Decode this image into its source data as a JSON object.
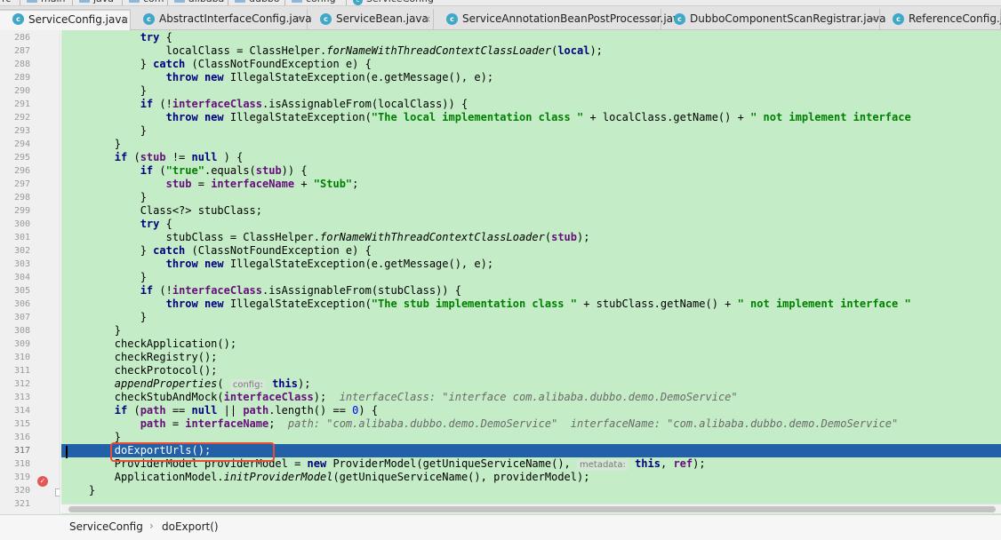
{
  "nav_breadcrumb": [
    {
      "label": "rc",
      "icon": "none"
    },
    {
      "label": "main",
      "icon": "folder-icon"
    },
    {
      "label": "java",
      "icon": "folder-icon"
    },
    {
      "label": "com",
      "icon": "folder-icon"
    },
    {
      "label": "alibaba",
      "icon": "folder-icon"
    },
    {
      "label": "dubbo",
      "icon": "folder-icon"
    },
    {
      "label": "config",
      "icon": "folder-icon"
    },
    {
      "label": "ServiceConfig",
      "icon": "class-icon"
    }
  ],
  "tabs": [
    {
      "label": "ServiceConfig.java",
      "active": true,
      "icon": "class-icon",
      "close": "×"
    },
    {
      "label": "AbstractInterfaceConfig.java",
      "active": false,
      "icon": "class-icon",
      "close": "×"
    },
    {
      "label": "ServiceBean.java",
      "active": false,
      "icon": "class-icon",
      "close": "×"
    },
    {
      "label": "ServiceAnnotationBeanPostProcessor.java",
      "active": false,
      "icon": "class-icon",
      "close": "×"
    },
    {
      "label": "DubboComponentScanRegistrar.java",
      "active": false,
      "icon": "class-icon",
      "close": "×"
    },
    {
      "label": "ReferenceConfig.java",
      "active": false,
      "icon": "class-icon",
      "close": ""
    }
  ],
  "icon_letter": "c",
  "line_numbers": [
    "286",
    "287",
    "288",
    "289",
    "290",
    "291",
    "292",
    "293",
    "294",
    "295",
    "296",
    "297",
    "298",
    "299",
    "300",
    "301",
    "302",
    "303",
    "304",
    "305",
    "306",
    "307",
    "308",
    "309",
    "310",
    "311",
    "312",
    "313",
    "314",
    "315",
    "316",
    "317",
    "318",
    "319",
    "320",
    "321"
  ],
  "highlighted_line": "317",
  "breakpoint_icon": "✓",
  "code_lines": [
    [
      [
        "",
        "            "
      ],
      [
        "kw",
        "try"
      ],
      [
        "",
        " {"
      ]
    ],
    [
      [
        "",
        "                localClass = ClassHelper."
      ],
      [
        "ital",
        "forNameWithThreadContextClassLoader"
      ],
      [
        "",
        "("
      ],
      [
        "kw",
        "local"
      ],
      [
        "",
        ");"
      ]
    ],
    [
      [
        "",
        "            } "
      ],
      [
        "kw",
        "catch"
      ],
      [
        "",
        " (ClassNotFoundException e) {"
      ]
    ],
    [
      [
        "",
        "                "
      ],
      [
        "kw",
        "throw new"
      ],
      [
        "",
        " IllegalStateException(e.getMessage(), e);"
      ]
    ],
    [
      [
        "",
        "            }"
      ]
    ],
    [
      [
        "",
        "            "
      ],
      [
        "kw",
        "if"
      ],
      [
        "",
        " (!"
      ],
      [
        "fld",
        "interfaceClass"
      ],
      [
        "",
        ".isAssignableFrom(localClass)) {"
      ]
    ],
    [
      [
        "",
        "                "
      ],
      [
        "kw",
        "throw new"
      ],
      [
        "",
        " IllegalStateException("
      ],
      [
        "str",
        "\"The local implementation class \""
      ],
      [
        "",
        " + localClass.getName() + "
      ],
      [
        "str",
        "\" not implement interface "
      ]
    ],
    [
      [
        "",
        "            }"
      ]
    ],
    [
      [
        "",
        "        }"
      ]
    ],
    [
      [
        "",
        "        "
      ],
      [
        "kw",
        "if"
      ],
      [
        "",
        " ("
      ],
      [
        "fld",
        "stub"
      ],
      [
        "",
        " != "
      ],
      [
        "kw",
        "null"
      ],
      [
        "",
        " ) {"
      ]
    ],
    [
      [
        "",
        "            "
      ],
      [
        "kw",
        "if"
      ],
      [
        "",
        " ("
      ],
      [
        "str",
        "\"true\""
      ],
      [
        "",
        ".equals("
      ],
      [
        "fld",
        "stub"
      ],
      [
        "",
        ")) {"
      ]
    ],
    [
      [
        "",
        "                "
      ],
      [
        "fld",
        "stub"
      ],
      [
        "",
        " = "
      ],
      [
        "fld",
        "interfaceName"
      ],
      [
        "",
        " + "
      ],
      [
        "str",
        "\"Stub\""
      ],
      [
        "",
        ";"
      ]
    ],
    [
      [
        "",
        "            }"
      ]
    ],
    [
      [
        "",
        "            Class<?> stubClass;"
      ]
    ],
    [
      [
        "",
        "            "
      ],
      [
        "kw",
        "try"
      ],
      [
        "",
        " {"
      ]
    ],
    [
      [
        "",
        "                stubClass = ClassHelper."
      ],
      [
        "ital",
        "forNameWithThreadContextClassLoader"
      ],
      [
        "",
        "("
      ],
      [
        "fld",
        "stub"
      ],
      [
        "",
        ");"
      ]
    ],
    [
      [
        "",
        "            } "
      ],
      [
        "kw",
        "catch"
      ],
      [
        "",
        " (ClassNotFoundException e) {"
      ]
    ],
    [
      [
        "",
        "                "
      ],
      [
        "kw",
        "throw new"
      ],
      [
        "",
        " IllegalStateException(e.getMessage(), e);"
      ]
    ],
    [
      [
        "",
        "            }"
      ]
    ],
    [
      [
        "",
        "            "
      ],
      [
        "kw",
        "if"
      ],
      [
        "",
        " (!"
      ],
      [
        "fld",
        "interfaceClass"
      ],
      [
        "",
        ".isAssignableFrom(stubClass)) {"
      ]
    ],
    [
      [
        "",
        "                "
      ],
      [
        "kw",
        "throw new"
      ],
      [
        "",
        " IllegalStateException("
      ],
      [
        "str",
        "\"The stub implementation class \""
      ],
      [
        "",
        " + stubClass.getName() + "
      ],
      [
        "str",
        "\" not implement interface \""
      ]
    ],
    [
      [
        "",
        "            }"
      ]
    ],
    [
      [
        "",
        "        }"
      ]
    ],
    [
      [
        "",
        "        checkApplication();"
      ]
    ],
    [
      [
        "",
        "        checkRegistry();"
      ]
    ],
    [
      [
        "",
        "        checkProtocol();"
      ]
    ],
    [
      [
        "",
        "        "
      ],
      [
        "ital",
        "appendProperties"
      ],
      [
        "",
        "( "
      ],
      [
        "param-hint",
        "config:"
      ],
      [
        "",
        " "
      ],
      [
        "kw",
        "this"
      ],
      [
        "",
        ");"
      ]
    ],
    [
      [
        "",
        "        checkStubAndMock("
      ],
      [
        "fld",
        "interfaceClass"
      ],
      [
        "",
        ");  "
      ],
      [
        "hint",
        "interfaceClass: \"interface com.alibaba.dubbo.demo.DemoService\""
      ]
    ],
    [
      [
        "",
        "        "
      ],
      [
        "kw",
        "if"
      ],
      [
        "",
        " ("
      ],
      [
        "fld",
        "path"
      ],
      [
        "",
        " == "
      ],
      [
        "kw",
        "null"
      ],
      [
        "",
        " || "
      ],
      [
        "fld",
        "path"
      ],
      [
        "",
        ".length() == "
      ],
      [
        "num",
        "0"
      ],
      [
        "",
        ") {"
      ]
    ],
    [
      [
        "",
        "            "
      ],
      [
        "fld",
        "path"
      ],
      [
        "",
        " = "
      ],
      [
        "fld",
        "interfaceName"
      ],
      [
        "",
        ";  "
      ],
      [
        "hint",
        "path: \"com.alibaba.dubbo.demo.DemoService\"  interfaceName: \"com.alibaba.dubbo.demo.DemoService\""
      ]
    ],
    [
      [
        "",
        "        }"
      ]
    ],
    [
      [
        "method",
        "        doExportUrls();"
      ]
    ],
    [
      [
        "",
        "        ProviderModel providerModel = "
      ],
      [
        "kw",
        "new"
      ],
      [
        "",
        " ProviderModel(getUniqueServiceName(), "
      ],
      [
        "param-hint",
        "metadata:"
      ],
      [
        "",
        " "
      ],
      [
        "kw",
        "this"
      ],
      [
        "",
        ", "
      ],
      [
        "fld",
        "ref"
      ],
      [
        "",
        ");"
      ]
    ],
    [
      [
        "",
        "        ApplicationModel."
      ],
      [
        "ital",
        "initProviderModel"
      ],
      [
        "",
        "(getUniqueServiceName(), providerModel);"
      ]
    ],
    [
      [
        "",
        "    }"
      ]
    ],
    [
      [
        "",
        ""
      ]
    ]
  ],
  "footer": {
    "class_name": "ServiceConfig",
    "separator": "›",
    "method_name": "doExport()"
  },
  "colors": {
    "code_background": "#c4ecc6",
    "highlight_line": "#2260a8",
    "annotation_box": "#e84e37"
  }
}
